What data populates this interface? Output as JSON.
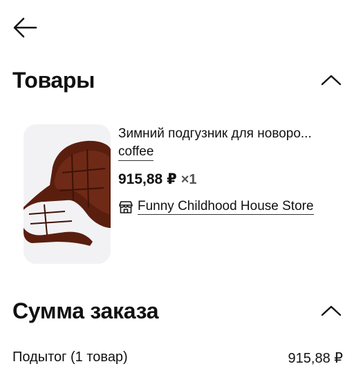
{
  "nav": {
    "back_icon": "arrow-left-icon"
  },
  "goods_section": {
    "title": "Товары",
    "toggle_icon": "chevron-up-icon"
  },
  "product": {
    "image": "brown stroller seat liner",
    "title": "Зимний подгузник для новоро...",
    "variant": "coffee",
    "price": "915,88 ₽",
    "quantity": "×1",
    "store_icon": "storefront-icon",
    "store_name": "Funny Childhood House Store"
  },
  "summary_section": {
    "title": "Сумма заказа",
    "toggle_icon": "chevron-up-icon",
    "subtotal_label": "Подытог (1 товар)",
    "subtotal_value": "915,88 ₽"
  },
  "colors": {
    "text": "#111111",
    "muted": "#555555",
    "thumb_bg": "#f2f2f4",
    "product_brown": "#5a1e0f"
  }
}
